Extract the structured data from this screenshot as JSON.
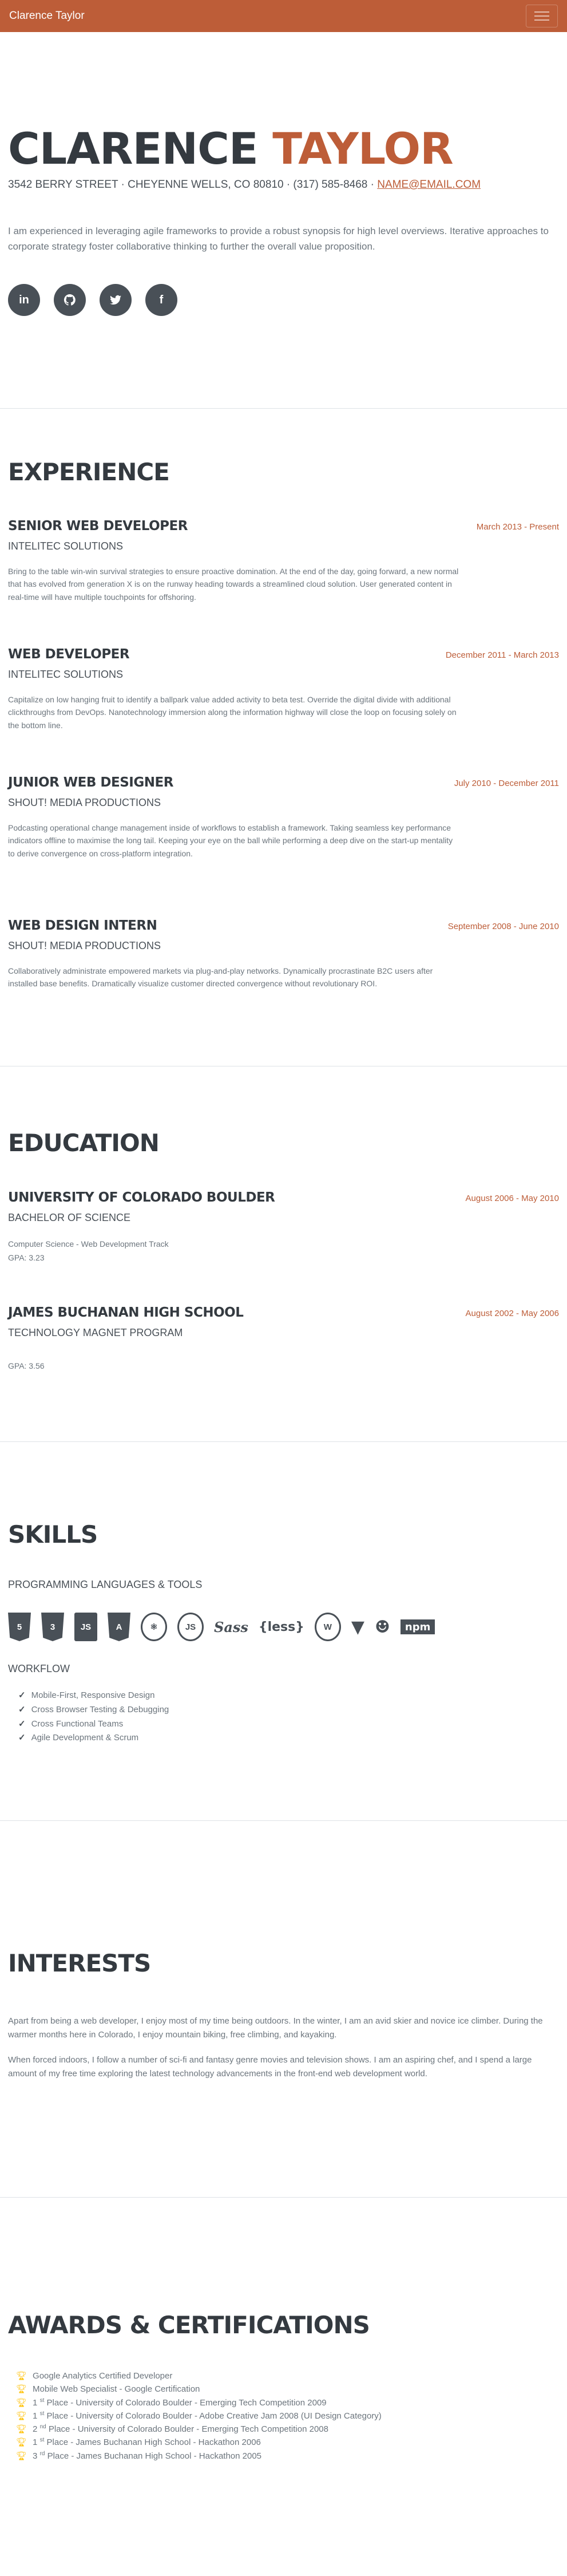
{
  "nav": {
    "brand": "Clarence Taylor",
    "toggle_icon": "hamburger-icon"
  },
  "about": {
    "first_name": "Clarence",
    "last_name": "Taylor",
    "address": "3542 Berry Street · Cheyenne Wells, CO 80810 · (317) 585-8468 ·",
    "email": "name@email.com",
    "summary": "I am experienced in leveraging agile frameworks to provide a robust synopsis for high level overviews. Iterative approaches to corporate strategy foster collaborative thinking to further the overall value proposition.",
    "socials": [
      {
        "icon": "linkedin-icon",
        "glyph": "in"
      },
      {
        "icon": "github-icon",
        "glyph": ""
      },
      {
        "icon": "twitter-icon",
        "glyph": ""
      },
      {
        "icon": "facebook-icon",
        "glyph": "f"
      }
    ]
  },
  "experience": {
    "title": "Experience",
    "items": [
      {
        "role": "Senior Web Developer",
        "org": "Intelitec Solutions",
        "date": "March 2013 - Present",
        "desc": "Bring to the table win-win survival strategies to ensure proactive domination. At the end of the day, going forward, a new normal that has evolved from generation X is on the runway heading towards a streamlined cloud solution. User generated content in real-time will have multiple touchpoints for offshoring."
      },
      {
        "role": "Web Developer",
        "org": "Intelitec Solutions",
        "date": "December 2011 - March 2013",
        "desc": "Capitalize on low hanging fruit to identify a ballpark value added activity to beta test. Override the digital divide with additional clickthroughs from DevOps. Nanotechnology immersion along the information highway will close the loop on focusing solely on the bottom line."
      },
      {
        "role": "Junior Web Designer",
        "org": "Shout! Media Productions",
        "date": "July 2010 - December 2011",
        "desc": "Podcasting operational change management inside of workflows to establish a framework. Taking seamless key performance indicators offline to maximise the long tail. Keeping your eye on the ball while performing a deep dive on the start-up mentality to derive convergence on cross-platform integration."
      },
      {
        "role": "Web Design Intern",
        "org": "Shout! Media Productions",
        "date": "September 2008 - June 2010",
        "desc": "Collaboratively administrate empowered markets via plug-and-play networks. Dynamically procrastinate B2C users after installed base benefits. Dramatically visualize customer directed convergence without revolutionary ROI."
      }
    ]
  },
  "education": {
    "title": "Education",
    "items": [
      {
        "school": "University of Colorado Boulder",
        "degree": "Bachelor of Science",
        "date": "August 2006 - May 2010",
        "track": "Computer Science - Web Development Track",
        "gpa": "GPA: 3.23"
      },
      {
        "school": "James Buchanan High School",
        "degree": "Technology Magnet Program",
        "date": "August 2002 - May 2006",
        "track": "",
        "gpa": "GPA: 3.56"
      }
    ]
  },
  "skills": {
    "title": "Skills",
    "languages_heading": "Programming Languages & Tools",
    "tools": [
      {
        "icon": "html5-icon",
        "glyph": "5"
      },
      {
        "icon": "css3-icon",
        "glyph": "3"
      },
      {
        "icon": "javascript-icon",
        "glyph": "JS"
      },
      {
        "icon": "angular-icon",
        "glyph": "A"
      },
      {
        "icon": "react-icon",
        "glyph": "⚛"
      },
      {
        "icon": "nodejs-icon",
        "glyph": "JS"
      },
      {
        "icon": "sass-icon",
        "glyph": "Sass"
      },
      {
        "icon": "less-icon",
        "glyph": "{less}"
      },
      {
        "icon": "wordpress-icon",
        "glyph": "W"
      },
      {
        "icon": "gulp-icon",
        "glyph": "▼"
      },
      {
        "icon": "grunt-icon",
        "glyph": "☻"
      },
      {
        "icon": "npm-icon",
        "glyph": "npm"
      }
    ],
    "workflow_heading": "Workflow",
    "workflow": [
      "Mobile-First, Responsive Design",
      "Cross Browser Testing & Debugging",
      "Cross Functional Teams",
      "Agile Development & Scrum"
    ]
  },
  "interests": {
    "title": "Interests",
    "p1": "Apart from being a web developer, I enjoy most of my time being outdoors. In the winter, I am an avid skier and novice ice climber. During the warmer months here in Colorado, I enjoy mountain biking, free climbing, and kayaking.",
    "p2": "When forced indoors, I follow a number of sci-fi and fantasy genre movies and television shows. I am an aspiring chef, and I spend a large amount of my free time exploring the latest technology advancements in the front-end web development world."
  },
  "awards": {
    "title": "Awards & Certifications",
    "items": [
      {
        "num": "",
        "sup": "",
        "text": "Google Analytics Certified Developer"
      },
      {
        "num": "",
        "sup": "",
        "text": "Mobile Web Specialist - Google Certification"
      },
      {
        "num": "1",
        "sup": "st",
        "text": " Place - University of Colorado Boulder - Emerging Tech Competition 2009"
      },
      {
        "num": "1",
        "sup": "st",
        "text": " Place - University of Colorado Boulder - Adobe Creative Jam 2008 (UI Design Category)"
      },
      {
        "num": "2",
        "sup": "nd",
        "text": " Place - University of Colorado Boulder - Emerging Tech Competition 2008"
      },
      {
        "num": "1",
        "sup": "st",
        "text": " Place - James Buchanan High School - Hackathon 2006"
      },
      {
        "num": "3",
        "sup": "rd",
        "text": " Place - James Buchanan High School - Hackathon 2005"
      }
    ]
  },
  "colors": {
    "primary": "#bd5d38",
    "text_dark": "#343a40",
    "text_muted": "#6c757d",
    "trophy": "#ffc107"
  }
}
